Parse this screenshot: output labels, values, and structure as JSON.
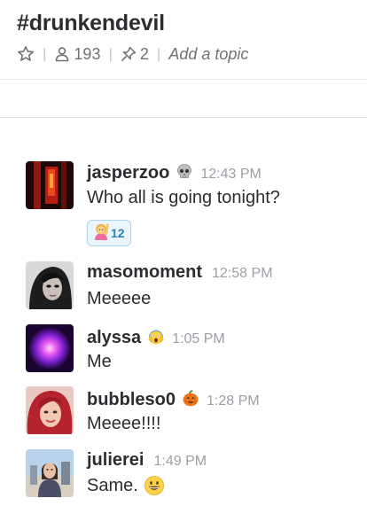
{
  "channel": {
    "title": "#drunkendevil",
    "member_count": "193",
    "pinned_count": "2",
    "topic_placeholder": "Add a topic"
  },
  "icons": {
    "star": "star-icon",
    "members": "person-icon",
    "pins": "pin-icon"
  },
  "colors": {
    "text": "#2c2d30",
    "muted": "#717274",
    "timestamp": "#9e9ea6",
    "reaction_border": "#a9d4ee",
    "reaction_bg": "#eaf5fc",
    "reaction_count": "#2a80b9"
  },
  "messages": [
    {
      "author": "jasperzoo",
      "status_emoji": "skull",
      "time": "12:43 PM",
      "text": "Who all is going tonight?",
      "reaction": {
        "emoji": "woman-raising-hand",
        "count": "12"
      }
    },
    {
      "author": "masomoment",
      "time": "12:58 PM",
      "text": "Meeeee"
    },
    {
      "author": "alyssa",
      "status_emoji": "scream",
      "time": "1:05 PM",
      "text": "Me"
    },
    {
      "author": "bubbleso0",
      "status_emoji": "jack-o-lantern",
      "time": "1:28 PM",
      "text": "Meeee!!!!"
    },
    {
      "author": "julierei",
      "time": "1:49 PM",
      "text": "Same.",
      "inline_emoji": "grinning-face"
    }
  ]
}
